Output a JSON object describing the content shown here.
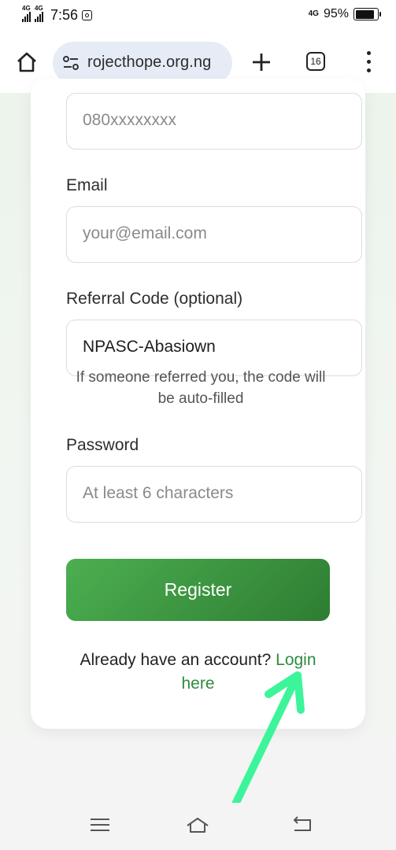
{
  "status_bar": {
    "network_1": "4G",
    "network_2": "4G",
    "time": "7:56",
    "data_indicator": "4G",
    "battery_percent": "95%",
    "battery_level": 0.95
  },
  "browser": {
    "url_text": "rojecthope.org.ng",
    "tab_count": "16",
    "icons": [
      "home-icon",
      "site-settings-icon",
      "new-tab-icon",
      "tabs-icon",
      "more-menu-icon"
    ]
  },
  "form": {
    "phone_value": "080xxxxxxxx",
    "email_label": "Email",
    "email_placeholder": "your@email.com",
    "referral_label": "Referral Code (optional)",
    "referral_value": "NPASC-Abasiown",
    "referral_hint": "If someone referred you, the code will be auto-filled",
    "password_label": "Password",
    "password_placeholder": "At least 6 characters",
    "register_label": "Register",
    "login_prompt": "Already have an account? ",
    "login_link": "Login here"
  },
  "colors": {
    "accent_green": "#2e8b3e",
    "button_gradient_start": "#4caf50",
    "button_gradient_end": "#2e7d32",
    "annotation_arrow": "#3cf59a"
  },
  "nav": {
    "icons": [
      "menu-icon",
      "home-icon",
      "back-icon"
    ]
  }
}
